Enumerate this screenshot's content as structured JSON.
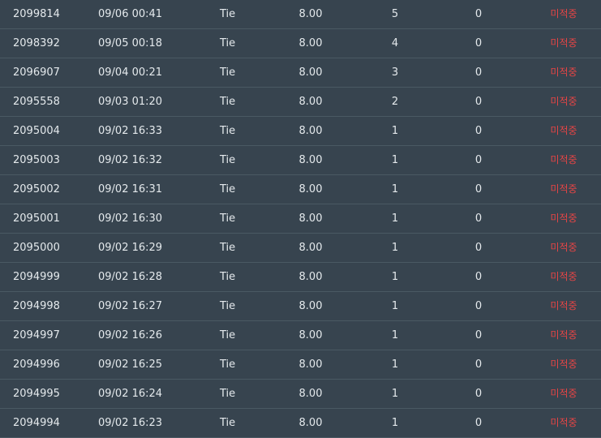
{
  "colors": {
    "background": "#37444f",
    "divider": "#4a5963",
    "text": "#e4e9ec",
    "status_pending": "#e64545"
  },
  "rows": [
    {
      "id": "2099814",
      "time": "09/06 00:41",
      "bet": "Tie",
      "odds": "8.00",
      "count": "5",
      "win": "0",
      "status": "미적중"
    },
    {
      "id": "2098392",
      "time": "09/05 00:18",
      "bet": "Tie",
      "odds": "8.00",
      "count": "4",
      "win": "0",
      "status": "미적중"
    },
    {
      "id": "2096907",
      "time": "09/04 00:21",
      "bet": "Tie",
      "odds": "8.00",
      "count": "3",
      "win": "0",
      "status": "미적중"
    },
    {
      "id": "2095558",
      "time": "09/03 01:20",
      "bet": "Tie",
      "odds": "8.00",
      "count": "2",
      "win": "0",
      "status": "미적중"
    },
    {
      "id": "2095004",
      "time": "09/02 16:33",
      "bet": "Tie",
      "odds": "8.00",
      "count": "1",
      "win": "0",
      "status": "미적중"
    },
    {
      "id": "2095003",
      "time": "09/02 16:32",
      "bet": "Tie",
      "odds": "8.00",
      "count": "1",
      "win": "0",
      "status": "미적중"
    },
    {
      "id": "2095002",
      "time": "09/02 16:31",
      "bet": "Tie",
      "odds": "8.00",
      "count": "1",
      "win": "0",
      "status": "미적중"
    },
    {
      "id": "2095001",
      "time": "09/02 16:30",
      "bet": "Tie",
      "odds": "8.00",
      "count": "1",
      "win": "0",
      "status": "미적중"
    },
    {
      "id": "2095000",
      "time": "09/02 16:29",
      "bet": "Tie",
      "odds": "8.00",
      "count": "1",
      "win": "0",
      "status": "미적중"
    },
    {
      "id": "2094999",
      "time": "09/02 16:28",
      "bet": "Tie",
      "odds": "8.00",
      "count": "1",
      "win": "0",
      "status": "미적중"
    },
    {
      "id": "2094998",
      "time": "09/02 16:27",
      "bet": "Tie",
      "odds": "8.00",
      "count": "1",
      "win": "0",
      "status": "미적중"
    },
    {
      "id": "2094997",
      "time": "09/02 16:26",
      "bet": "Tie",
      "odds": "8.00",
      "count": "1",
      "win": "0",
      "status": "미적중"
    },
    {
      "id": "2094996",
      "time": "09/02 16:25",
      "bet": "Tie",
      "odds": "8.00",
      "count": "1",
      "win": "0",
      "status": "미적중"
    },
    {
      "id": "2094995",
      "time": "09/02 16:24",
      "bet": "Tie",
      "odds": "8.00",
      "count": "1",
      "win": "0",
      "status": "미적중"
    },
    {
      "id": "2094994",
      "time": "09/02 16:23",
      "bet": "Tie",
      "odds": "8.00",
      "count": "1",
      "win": "0",
      "status": "미적중"
    }
  ]
}
